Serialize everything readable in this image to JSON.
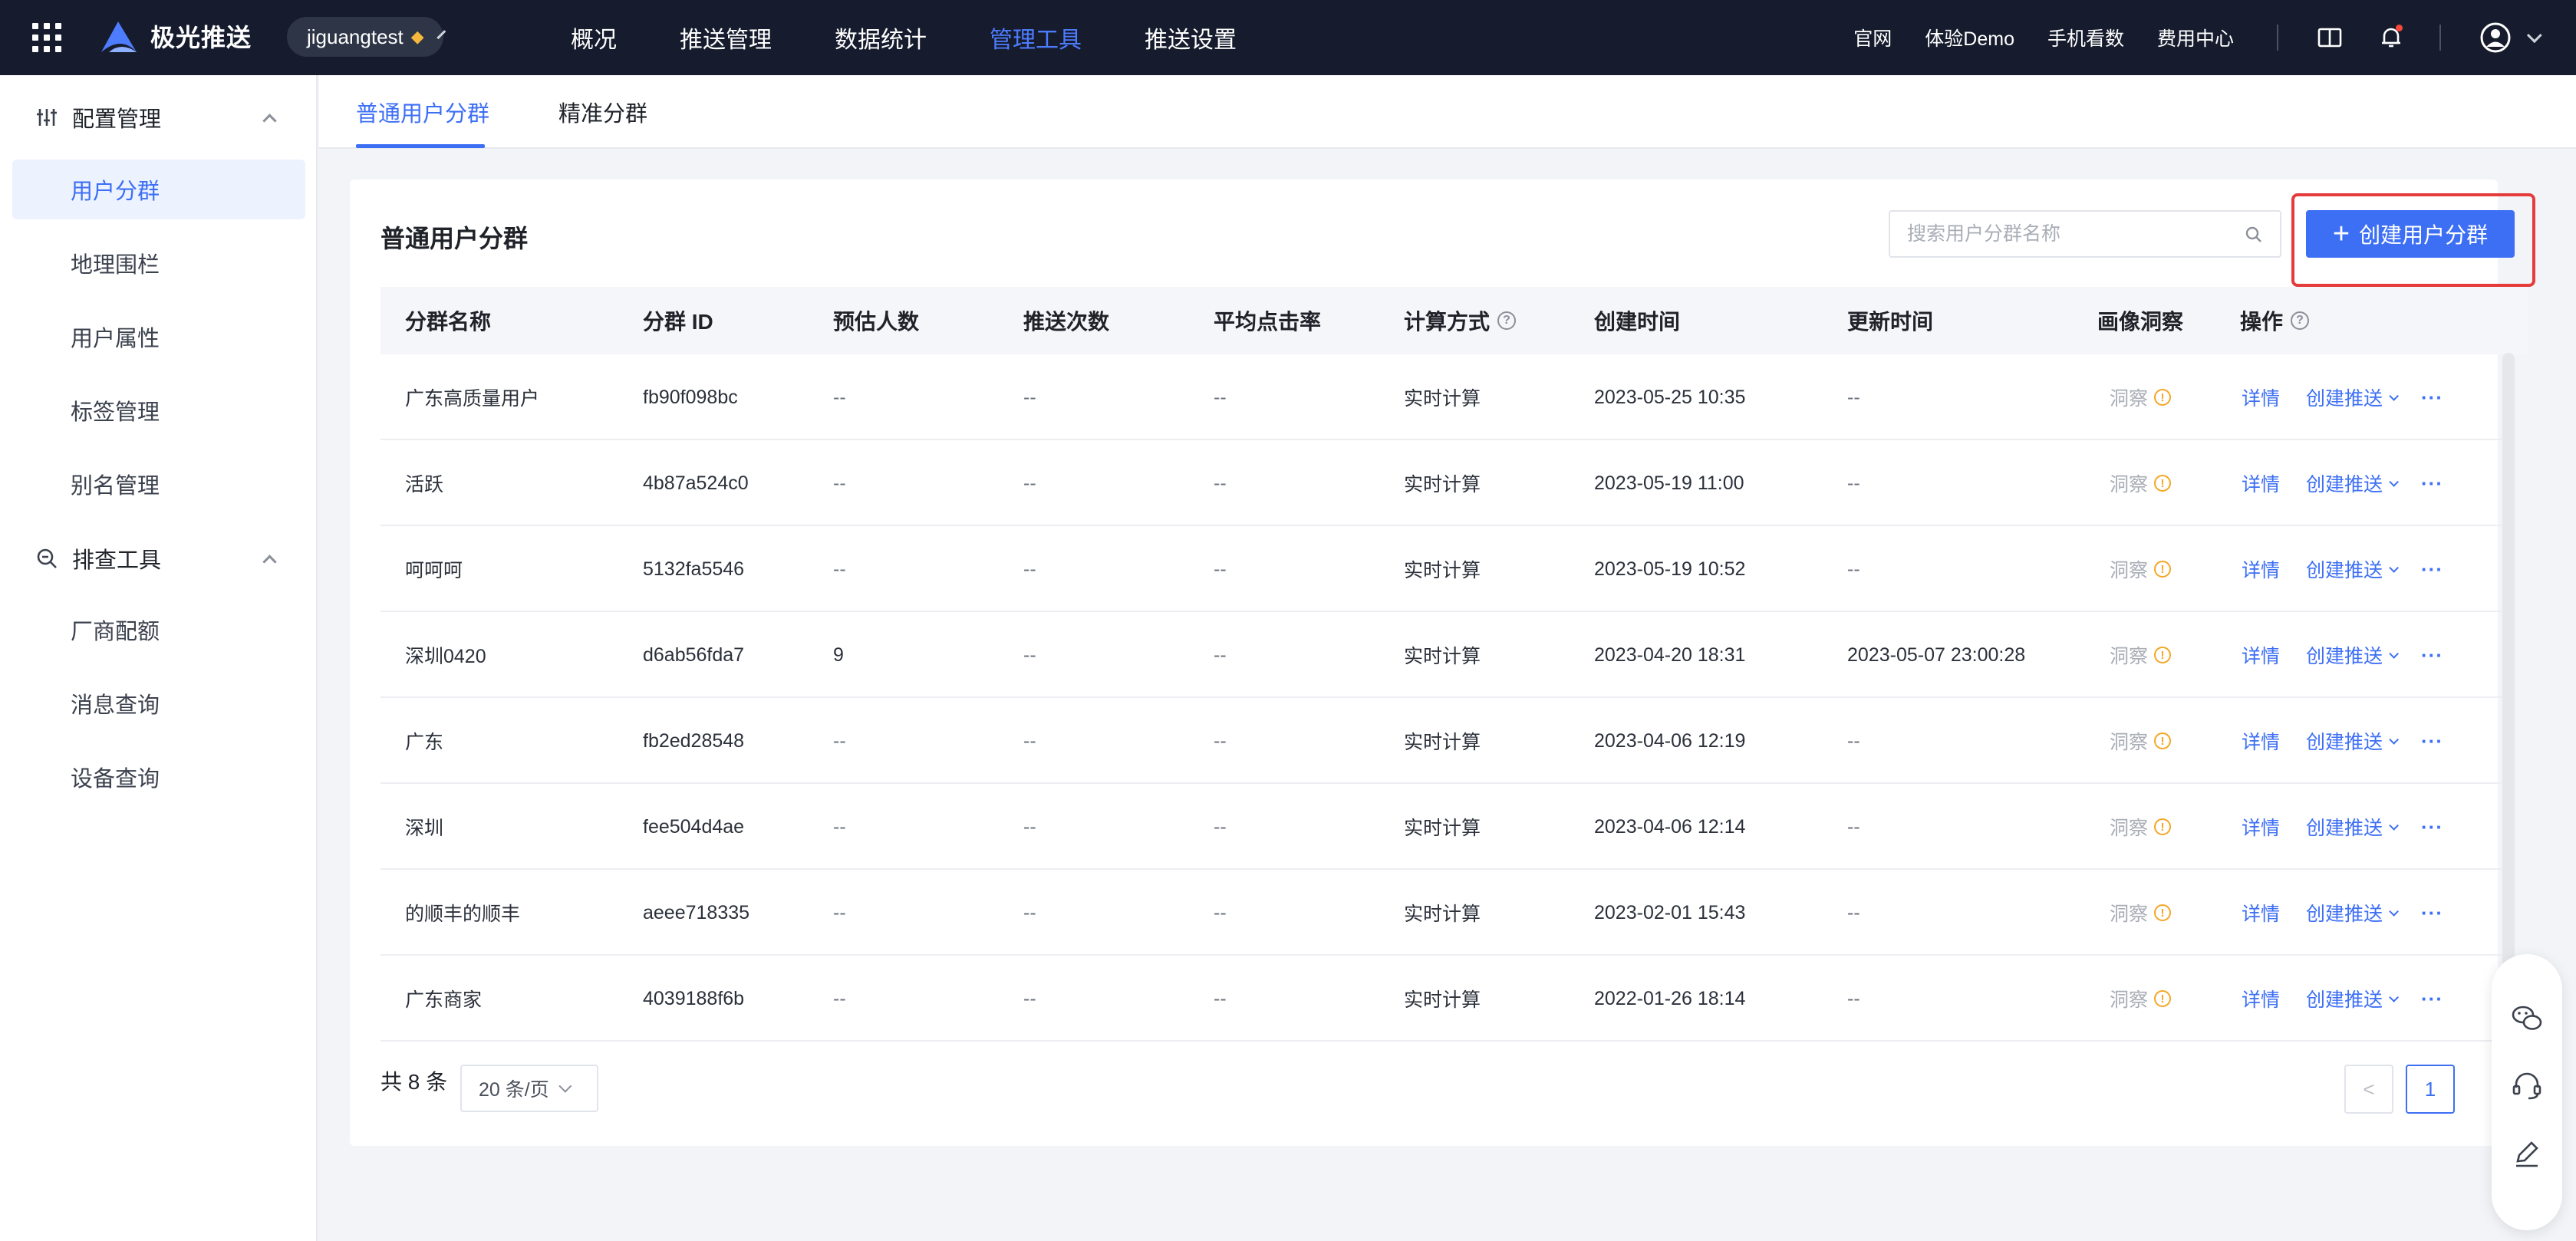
{
  "header": {
    "brand": "极光推送",
    "app_name": "jiguangtest",
    "nav": [
      "概况",
      "推送管理",
      "数据统计",
      "管理工具",
      "推送设置"
    ],
    "active_nav": "管理工具",
    "links": [
      "官网",
      "体验Demo",
      "手机看数",
      "费用中心"
    ]
  },
  "sidebar": {
    "groups": [
      {
        "label": "配置管理",
        "icon": "sliders-icon"
      },
      {
        "label": "排查工具",
        "icon": "search-zoom-icon"
      }
    ],
    "items": [
      "用户分群",
      "地理围栏",
      "用户属性",
      "标签管理",
      "别名管理",
      "厂商配额",
      "消息查询",
      "设备查询"
    ],
    "active_item": "用户分群"
  },
  "tabs": [
    "普通用户分群",
    "精准分群"
  ],
  "active_tab": "普通用户分群",
  "card": {
    "title": "普通用户分群",
    "search_placeholder": "搜索用户分群名称",
    "create_label": "创建用户分群"
  },
  "table": {
    "columns": [
      "分群名称",
      "分群 ID",
      "预估人数",
      "推送次数",
      "平均点击率",
      "计算方式",
      "创建时间",
      "更新时间",
      "画像洞察",
      "操作"
    ],
    "rows": [
      {
        "name": "广东高质量用户",
        "id": "fb90f098bc",
        "est": "--",
        "pushes": "--",
        "ctr": "--",
        "calc": "实时计算",
        "created": "2023-05-25 10:35",
        "updated": "--"
      },
      {
        "name": "活跃",
        "id": "4b87a524c0",
        "est": "--",
        "pushes": "--",
        "ctr": "--",
        "calc": "实时计算",
        "created": "2023-05-19 11:00",
        "updated": "--"
      },
      {
        "name": "呵呵呵",
        "id": "5132fa5546",
        "est": "--",
        "pushes": "--",
        "ctr": "--",
        "calc": "实时计算",
        "created": "2023-05-19 10:52",
        "updated": "--"
      },
      {
        "name": "深圳0420",
        "id": "d6ab56fda7",
        "est": "9",
        "pushes": "--",
        "ctr": "--",
        "calc": "实时计算",
        "created": "2023-04-20 18:31",
        "updated": "2023-05-07 23:00:28"
      },
      {
        "name": "广东",
        "id": "fb2ed28548",
        "est": "--",
        "pushes": "--",
        "ctr": "--",
        "calc": "实时计算",
        "created": "2023-04-06 12:19",
        "updated": "--"
      },
      {
        "name": "深圳",
        "id": "fee504d4ae",
        "est": "--",
        "pushes": "--",
        "ctr": "--",
        "calc": "实时计算",
        "created": "2023-04-06 12:14",
        "updated": "--"
      },
      {
        "name": "的顺丰的顺丰",
        "id": "aeee718335",
        "est": "--",
        "pushes": "--",
        "ctr": "--",
        "calc": "实时计算",
        "created": "2023-02-01 15:43",
        "updated": "--"
      },
      {
        "name": "广东商家",
        "id": "4039188f6b",
        "est": "--",
        "pushes": "--",
        "ctr": "--",
        "calc": "实时计算",
        "created": "2022-01-26 18:14",
        "updated": "--"
      }
    ],
    "insight_label": "洞察",
    "detail_label": "详情",
    "push_label": "创建推送",
    "more_label": "···"
  },
  "pagination": {
    "total": "共 8 条",
    "page_size": "20 条/页",
    "current_page": "1"
  },
  "colors": {
    "accent": "#3d6ff5",
    "topbar": "#161c2d",
    "highlight": "#e53b3b",
    "warning": "#f5a623"
  }
}
